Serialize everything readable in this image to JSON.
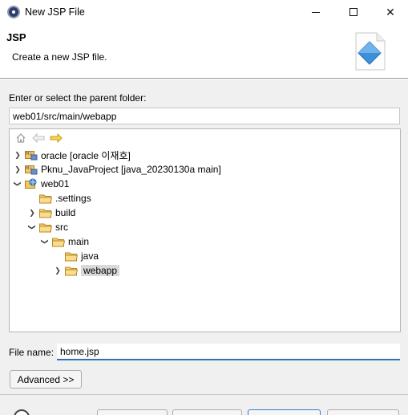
{
  "window": {
    "title": "New JSP File"
  },
  "header": {
    "title": "JSP",
    "description": "Create a new JSP file."
  },
  "parent_folder": {
    "label": "Enter or select the parent folder:",
    "value": "web01/src/main/webapp"
  },
  "tree": {
    "items": [
      {
        "label": "oracle [oracle 이재호]",
        "type": "project",
        "expanded": false
      },
      {
        "label": "Pknu_JavaProject [java_20230130a main]",
        "type": "project",
        "expanded": false
      },
      {
        "label": "web01",
        "type": "project",
        "expanded": true
      },
      {
        "label": ".settings",
        "type": "folder",
        "expanded": false
      },
      {
        "label": "build",
        "type": "folder",
        "expanded": false
      },
      {
        "label": "src",
        "type": "folder",
        "expanded": true
      },
      {
        "label": "main",
        "type": "folder",
        "expanded": true
      },
      {
        "label": "java",
        "type": "folder",
        "expanded": false
      },
      {
        "label": "webapp",
        "type": "folder",
        "expanded": false,
        "selected": true
      }
    ]
  },
  "file_name": {
    "label": "File name:",
    "value": "home.jsp"
  },
  "advanced_button": {
    "label": "Advanced >>"
  },
  "colors": {
    "accent": "#2f6fb6",
    "folder": "#e8b84a",
    "selection": "#d9d9d9"
  }
}
